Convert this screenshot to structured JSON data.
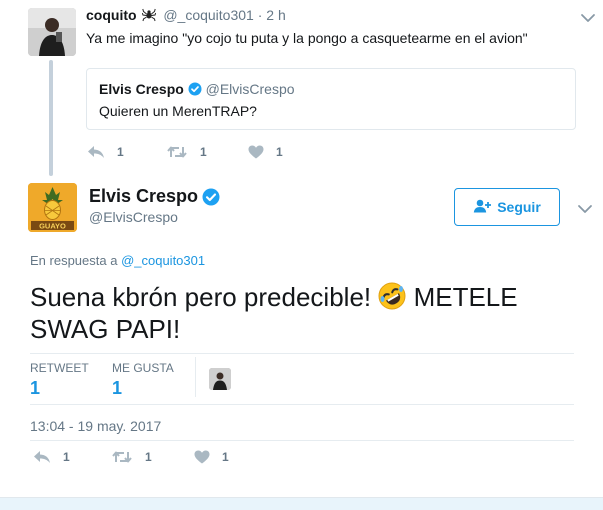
{
  "parent_tweet": {
    "name": "coquito",
    "name_emoji_icon": "spider-icon",
    "handle": "@_coquito301",
    "separator": "·",
    "time": "2 h",
    "text": "Ya me imagino \"yo cojo tu puta y la pongo a casquetearme en el avion\"",
    "quoted": {
      "name": "Elvis Crespo",
      "verified": true,
      "handle": "@ElvisCrespo",
      "text": "Quieren un MerenTRAP?"
    },
    "actions": {
      "reply_count": "1",
      "retweet_count": "1",
      "like_count": "1"
    }
  },
  "main_tweet": {
    "name": "Elvis Crespo",
    "verified": true,
    "handle": "@ElvisCrespo",
    "follow_label": "Seguir",
    "reply_prefix": "En respuesta a ",
    "reply_handle": "@_coquito301",
    "text_before_emoji": "Suena kbrón pero predecible! ",
    "emoji": "rolling-on-floor-laughing-icon",
    "text_after_emoji": " METELE SWAG PAPI!",
    "stats": {
      "retweet_label": "RETWEET",
      "retweet_count": "1",
      "like_label": "ME GUSTA",
      "like_count": "1"
    },
    "timestamp": "13:04 - 19 may. 2017",
    "actions": {
      "reply_count": "1",
      "retweet_count": "1",
      "like_count": "1"
    }
  },
  "colors": {
    "accent": "#1b95e0",
    "secondary_text": "#657786",
    "thread_line": "#c4d0db",
    "verified": "#1da1f2"
  }
}
